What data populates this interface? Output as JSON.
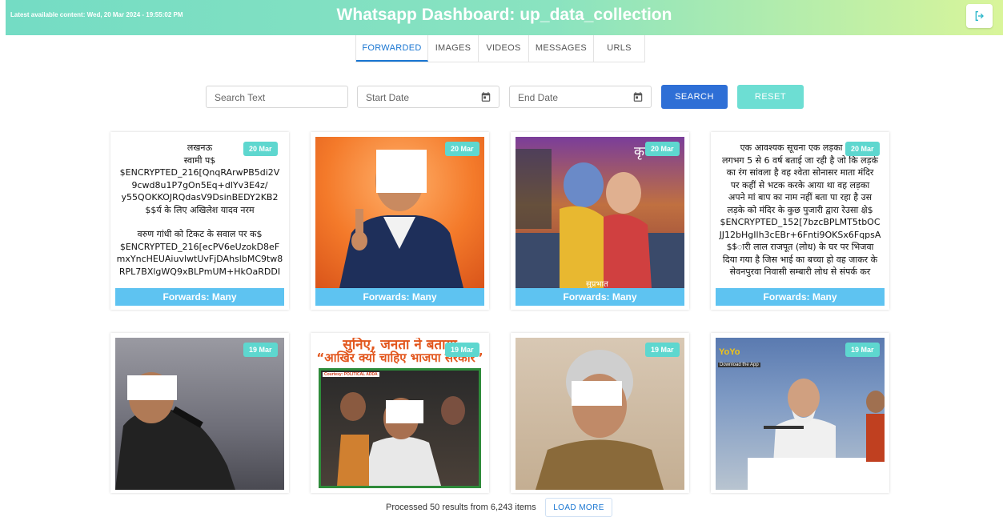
{
  "header": {
    "latest_content": "Latest available content: Wed, 20 Mar 2024 - 19:55:02 PM",
    "title": "Whatsapp Dashboard: up_data_collection",
    "logout_icon": "logout-icon"
  },
  "tabs": [
    {
      "label": "FORWARDED",
      "active": true
    },
    {
      "label": "IMAGES",
      "active": false
    },
    {
      "label": "VIDEOS",
      "active": false
    },
    {
      "label": "MESSAGES",
      "active": false
    },
    {
      "label": "URLS",
      "active": false
    }
  ],
  "search": {
    "text_placeholder": "Search Text",
    "start_placeholder": "Start Date",
    "end_placeholder": "End Date",
    "search_label": "SEARCH",
    "reset_label": "RESET",
    "calendar_icon": "calendar-icon"
  },
  "colors": {
    "accent": "#1976d2",
    "search_button": "#2e6fd6",
    "reset_button": "#6dded3",
    "badge": "#5ed7cf",
    "forwards_bar": "#5ec3f1"
  },
  "cards": [
    {
      "type": "text",
      "date": "20 Mar",
      "forwards": "Forwards: Many",
      "text_lines": [
        "लखनऊ",
        "स्वामी प$",
        "$ENCRYPTED_216[QnqRArwPB5di2V",
        "9cwd8u1P7gOn5Eq+dlYv3E4z/",
        "y55QOKKOJRQdasV9DsinBEDY2KB2",
        "$$र्य के लिए अखिलेश यादव नरम",
        "",
        "वरुण गांधी को टिकट के सवाल पर क$",
        "$ENCRYPTED_216[ecPV6eUzokD8eF",
        "mxYncHEUAiuvlwtUvFjDAhslbMC9tw8",
        "RPL7BXlgWQ9xBLPmUM+HkOaRDDI"
      ]
    },
    {
      "type": "image",
      "date": "20 Mar",
      "forwards": "Forwards: Many"
    },
    {
      "type": "image",
      "date": "20 Mar",
      "forwards": "Forwards: Many",
      "overlay_text": "कृष्णा",
      "caption": "सुप्रभात"
    },
    {
      "type": "text",
      "date": "20 Mar",
      "forwards": "Forwards: Many",
      "text_lines": [
        "एक आवश्यक सूचना एक लड़का जिस",
        "लगभग 5 से 6 वर्ष बताई जा रही है जो कि लड़के",
        "का रंग सांवला है वह श्वेता सोनासर माता मंदिर",
        "पर कहीं से भटक करके आया था वह लड़का",
        "अपने मां बाप का नाम नहीं बता पा रहा है उस",
        "लड़के को मंदिर के कुछ पुजारी द्वारा रेउसा क्षे$",
        "$ENCRYPTED_152[7bzcBPLMT5tbOC",
        "JJ12bHgIlh3cEBr+6Fnti9OKSx6FqpsA",
        "$$ारी लाल राजपूत (लोध) के घर पर भिजवा",
        "दिया गया है जिस भाई का बच्चा हो वह जाकर के",
        "सेवनपुरवा निवासी सम्बारी लोध से संपर्क कर"
      ]
    },
    {
      "type": "image",
      "date": "19 Mar"
    },
    {
      "type": "image",
      "date": "19 Mar",
      "headline_top": "सुनिए, जनता ने बताया",
      "headline": "“आखिर क्यों चाहिए भाजपा सरकार”",
      "courtesy": "Courtesy: POLITICAL ADDA"
    },
    {
      "type": "image",
      "date": "19 Mar"
    },
    {
      "type": "image",
      "date": "19 Mar",
      "app_logo": "YoYo",
      "app_tag": "Download the App"
    }
  ],
  "footer": {
    "processed_text": "Processed 50 results from 6,243 items",
    "load_more_label": "LOAD MORE"
  }
}
